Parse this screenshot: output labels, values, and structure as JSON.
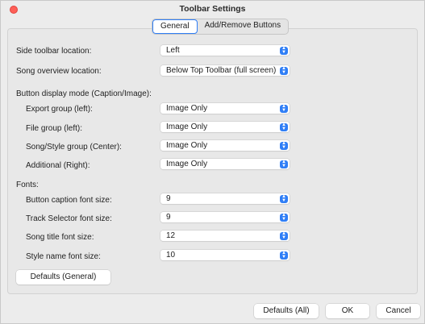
{
  "window": {
    "title": "Toolbar Settings"
  },
  "tabs": [
    {
      "label": "General",
      "selected": true
    },
    {
      "label": "Add/Remove Buttons",
      "selected": false
    }
  ],
  "general": {
    "side_toolbar": {
      "label": "Side toolbar location:",
      "value": "Left"
    },
    "song_overview": {
      "label": "Song overview location:",
      "value": "Below Top Toolbar (full screen)"
    },
    "button_display_heading": "Button display mode (Caption/Image):",
    "button_display": [
      {
        "label": "Export group (left):",
        "value": "Image Only"
      },
      {
        "label": "File group (left):",
        "value": "Image Only"
      },
      {
        "label": "Song/Style group (Center):",
        "value": "Image Only"
      },
      {
        "label": "Additional (Right):",
        "value": "Image Only"
      }
    ],
    "fonts_heading": "Fonts:",
    "fonts": [
      {
        "label": "Button caption font size:",
        "value": "9"
      },
      {
        "label": "Track Selector font size:",
        "value": "9"
      },
      {
        "label": "Song title font size:",
        "value": "12"
      },
      {
        "label": "Style name font size:",
        "value": "10"
      }
    ],
    "defaults_general_label": "Defaults (General)"
  },
  "footer": {
    "defaults_all_label": "Defaults (All)",
    "ok_label": "OK",
    "cancel_label": "Cancel"
  },
  "colors": {
    "accent": "#2f7ef6",
    "close_button": "#fe5f57"
  },
  "icons": {
    "popup_chevron": "chevron-up-down-icon",
    "close": "close-icon"
  }
}
